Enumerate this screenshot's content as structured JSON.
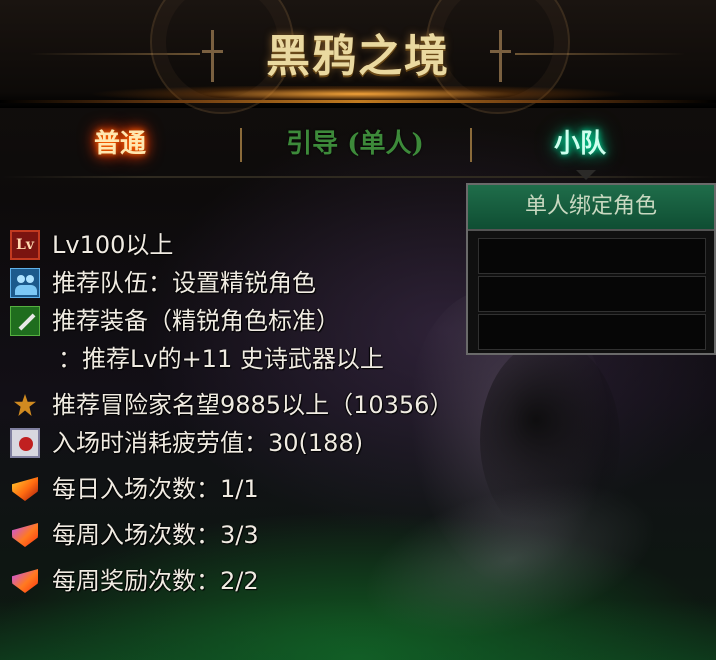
{
  "header": {
    "title": "黑鸦之境"
  },
  "tabs": [
    {
      "label": "普通",
      "state": "active"
    },
    {
      "label": "引导 (单人)",
      "state": "inactive"
    },
    {
      "label": "小队",
      "state": "highlighted"
    }
  ],
  "bind_panel": {
    "title": "单人绑定角色",
    "slots": [
      "",
      "",
      ""
    ]
  },
  "info": {
    "level": {
      "icon": "level-badge-icon",
      "icon_text": "Lv",
      "text": "Lv100以上"
    },
    "party": {
      "icon": "party-icon",
      "text": "推荐队伍：设置精锐角色"
    },
    "equipment": {
      "icon": "sword-icon",
      "text": "推荐装备（精锐角色标准）",
      "sub": "：推荐Lv的+11 史诗武器以上"
    },
    "fame": {
      "icon": "fame-icon",
      "text": "推荐冒险家名望9885以上（10356）"
    },
    "fatigue": {
      "icon": "fatigue-icon",
      "text": "入场时消耗疲劳值：30(188)"
    },
    "daily_entry": {
      "icon": "shield-icon",
      "text": "每日入场次数：1/1"
    },
    "weekly_entry": {
      "icon": "shield-icon",
      "text": "每周入场次数：3/3"
    },
    "weekly_reward": {
      "icon": "shield-icon",
      "text": "每周奖励次数：2/2"
    }
  },
  "colors": {
    "title": "#ead9a0",
    "tab_active_glow": "#ff6a00",
    "tab_team_glow": "#00e0a0",
    "bind_header": "#1f6d4a",
    "text": "#f0ebe2"
  }
}
